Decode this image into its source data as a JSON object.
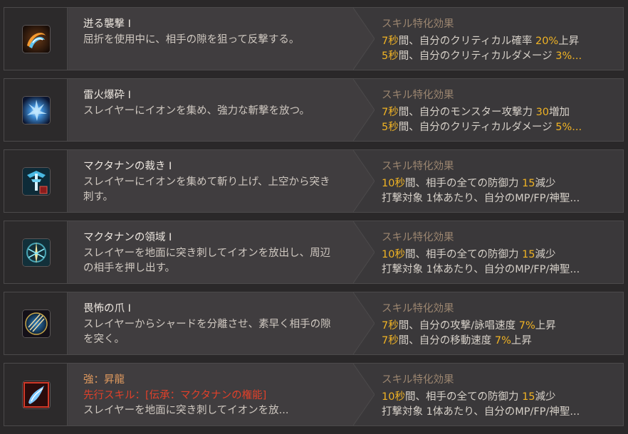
{
  "effect_header": "スキル特化効果",
  "colors": {
    "highlight": "#f0b324",
    "effect_header": "#9c8670",
    "orange_name": "#e09a5f",
    "prereq": "#e0402a"
  },
  "skills": [
    {
      "name": "迸る襲撃 I",
      "icon": "swirling-slash-icon",
      "desc": "屈折を使用中に、相手の隙を狙って反撃する。",
      "effects": [
        [
          {
            "t": "7秒",
            "h": true
          },
          {
            "t": "間、自分のクリティカル確率 "
          },
          {
            "t": "20%",
            "h": true
          },
          {
            "t": "上昇"
          }
        ],
        [
          {
            "t": "5秒",
            "h": true
          },
          {
            "t": "間、自分のクリティカルダメージ "
          },
          {
            "t": "3%...",
            "h": true
          }
        ]
      ]
    },
    {
      "name": "雷火爆砕 I",
      "icon": "ion-burst-icon",
      "desc": "スレイヤーにイオンを集め、強力な斬撃を放つ。",
      "effects": [
        [
          {
            "t": "7秒",
            "h": true
          },
          {
            "t": "間、自分のモンスター攻撃力 "
          },
          {
            "t": "30",
            "h": true
          },
          {
            "t": "増加"
          }
        ],
        [
          {
            "t": "5秒",
            "h": true
          },
          {
            "t": "間、自分のクリティカルダメージ "
          },
          {
            "t": "5%...",
            "h": true
          }
        ]
      ]
    },
    {
      "name": "マクタナンの裁き I",
      "icon": "sword-uppercut-icon",
      "desc": "スレイヤーにイオンを集めて斬り上げ、上空から突き刺す。",
      "effects": [
        [
          {
            "t": "10秒",
            "h": true
          },
          {
            "t": "間、相手の全ての防御力 "
          },
          {
            "t": "15",
            "h": true
          },
          {
            "t": "減少"
          }
        ],
        [
          {
            "t": "打撃対象 1体あたり、自分のMP/FP/神聖..."
          }
        ]
      ]
    },
    {
      "name": "マクタナンの領域 I",
      "icon": "ground-thrust-icon",
      "desc": "スレイヤーを地面に突き刺してイオンを放出し、周辺の相手を押し出す。",
      "effects": [
        [
          {
            "t": "10秒",
            "h": true
          },
          {
            "t": "間、相手の全ての防御力 "
          },
          {
            "t": "15",
            "h": true
          },
          {
            "t": "減少"
          }
        ],
        [
          {
            "t": "打撃対象 1体あたり、自分のMP/FP/神聖..."
          }
        ]
      ]
    },
    {
      "name": "畏怖の爪 I",
      "icon": "shard-claw-icon",
      "desc": "スレイヤーからシャードを分離させ、素早く相手の隙を突く。",
      "effects": [
        [
          {
            "t": "7秒",
            "h": true
          },
          {
            "t": "間、自分の攻撃/詠唱速度 "
          },
          {
            "t": "7%",
            "h": true
          },
          {
            "t": "上昇"
          }
        ],
        [
          {
            "t": "7秒",
            "h": true
          },
          {
            "t": "間、自分の移動速度 "
          },
          {
            "t": "7%",
            "h": true
          },
          {
            "t": "上昇"
          }
        ]
      ]
    },
    {
      "name": "強：昇龍",
      "name_style": "orange",
      "icon": "rising-dragon-icon",
      "prereq": "先行スキル：[伝承：マクタナンの権能]",
      "desc": "スレイヤーを地面に突き刺してイオンを放...",
      "effects": [
        [
          {
            "t": "10秒",
            "h": true
          },
          {
            "t": "間、相手の全ての防御力 "
          },
          {
            "t": "15",
            "h": true
          },
          {
            "t": "減少"
          }
        ],
        [
          {
            "t": "打撃対象 1体あたり、自分のMP/FP/神聖..."
          }
        ]
      ]
    }
  ]
}
